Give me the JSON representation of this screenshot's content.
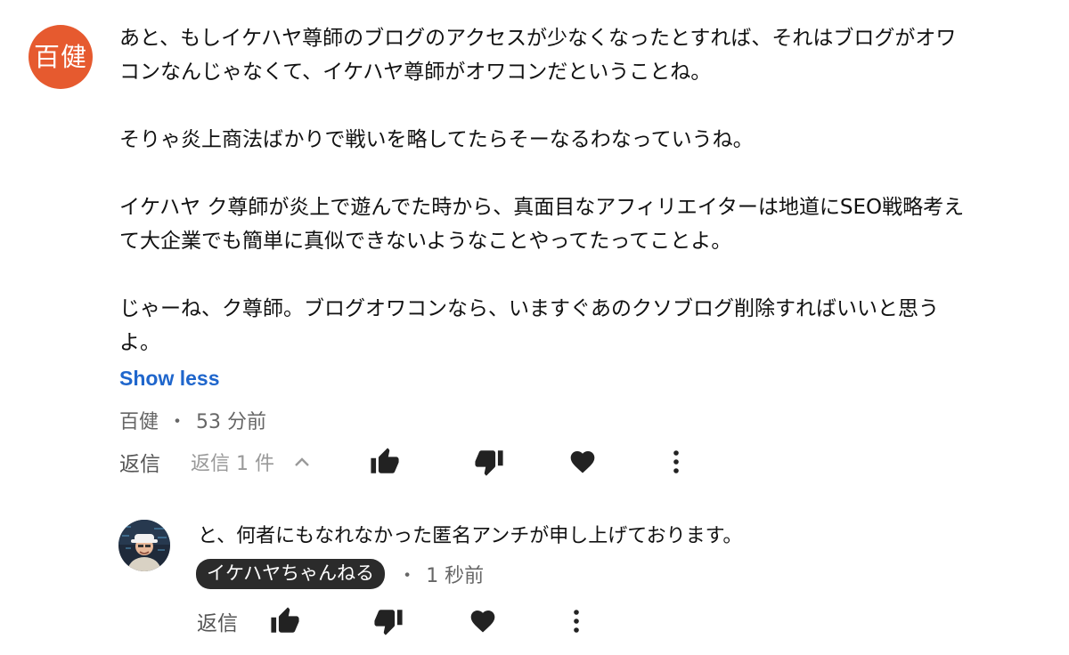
{
  "comment": {
    "avatar_text": "百健",
    "avatar_color": "#e65a2f",
    "paragraphs": [
      "あと、もしイケハヤ尊師のブログのアクセスが少なくなったとすれば、それはブログがオワコンなんじゃなくて、イケハヤ尊師がオワコンだということね。",
      "そりゃ炎上商法ばかりで戦いを略してたらそーなるわなっていうね。",
      "イケハヤ ク尊師が炎上で遊んでた時から、真面目なアフィリエイターは地道にSEO戦略考えて大企業でも簡単に真似できないようなことやってたってことよ。",
      "じゃーね、ク尊師。ブログオワコンなら、いますぐあのクソブログ削除すればいいと思うよ。"
    ],
    "show_less_label": "Show less",
    "author": "百健",
    "separator": "・",
    "time": "53 分前",
    "reply_label": "返信",
    "replies_count_label": "返信 1 件",
    "icons": {
      "collapse": "chevron-up-icon",
      "like": "thumbs-up-icon",
      "dislike": "thumbs-down-icon",
      "heart": "heart-icon",
      "more": "more-vertical-icon"
    }
  },
  "reply": {
    "text": "と、何者にもなれなかった匿名アンチが申し上げております。",
    "author_badge": "イケハヤちゃんねる",
    "separator": "・",
    "time": "1 秒前",
    "reply_label": "返信"
  },
  "colors": {
    "link": "#1f66cc",
    "icon": "#222222",
    "muted": "#666666",
    "badge_bg": "#2b2b2b"
  }
}
